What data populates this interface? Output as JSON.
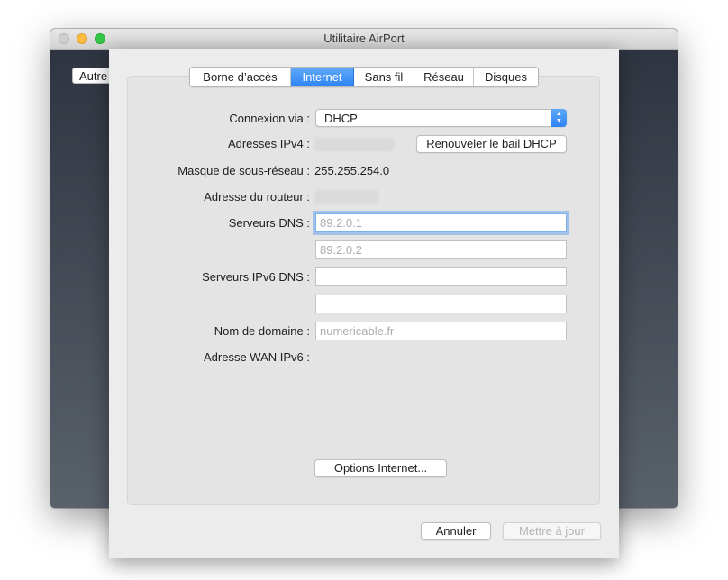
{
  "window": {
    "title": "Utilitaire AirPort",
    "background_button": "Autre"
  },
  "tabs": [
    {
      "label": "Borne d’accès",
      "active": false
    },
    {
      "label": "Internet",
      "active": true
    },
    {
      "label": "Sans fil",
      "active": false
    },
    {
      "label": "Réseau",
      "active": false
    },
    {
      "label": "Disques",
      "active": false
    }
  ],
  "form": {
    "connection_label": "Connexion via :",
    "connection_value": "DHCP",
    "ipv4_label": "Adresses IPv4 :",
    "renew_button": "Renouveler le bail DHCP",
    "subnet_label": "Masque de sous-réseau :",
    "subnet_value": "255.255.254.0",
    "router_label": "Adresse du routeur :",
    "dns_label": "Serveurs DNS :",
    "dns1_placeholder": "89.2.0.1",
    "dns2_placeholder": "89.2.0.2",
    "ipv6_dns_label": "Serveurs IPv6 DNS :",
    "domain_label": "Nom de domaine :",
    "domain_placeholder": "numericable.fr",
    "wan_ipv6_label": "Adresse WAN IPv6 :",
    "options_button": "Options Internet..."
  },
  "footer": {
    "cancel_button": "Annuler",
    "update_button": "Mettre à jour"
  },
  "colors": {
    "accent": "#2d84f6",
    "window_bg": "#3f4650",
    "sheet_bg": "#ececec"
  }
}
